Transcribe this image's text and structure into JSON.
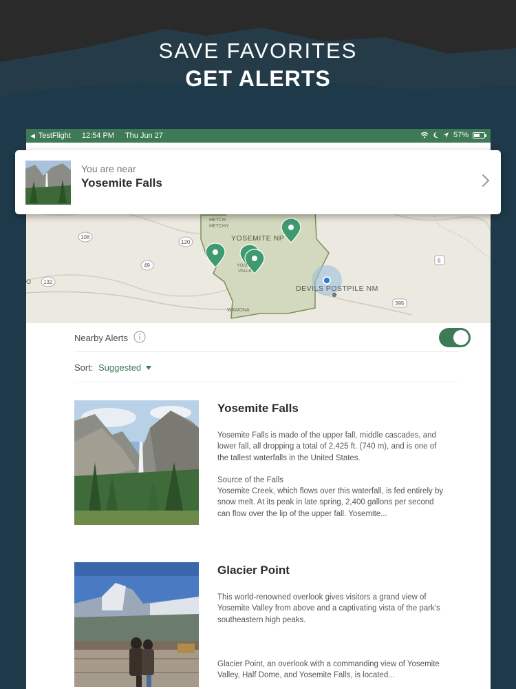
{
  "promo": {
    "line1": "SAVE FAVORITES",
    "line2": "GET ALERTS"
  },
  "statusbar": {
    "back_app": "TestFlight",
    "time": "12:54 PM",
    "date": "Thu Jun 27",
    "battery": "57%",
    "battery_level": 0.57
  },
  "near": {
    "subtitle": "You are near",
    "title": "Yosemite Falls"
  },
  "map": {
    "labels": {
      "hetch_1": "HETCH",
      "hetch_2": "HETCHY",
      "yosemite_np": "YOSEMITE NP",
      "yose_1": "YOSE",
      "yose_2": "VALLE",
      "devils_postpile": "DEVILS POSTPILE NM",
      "wawona": "WAWONA",
      "r108": "108",
      "r120": "120",
      "r49": "49",
      "r132": "132",
      "r6": "6",
      "r395": "395",
      "o_left": "O"
    }
  },
  "alerts": {
    "label": "Nearby Alerts",
    "enabled": true
  },
  "sort": {
    "label": "Sort:",
    "value": "Suggested"
  },
  "items": [
    {
      "title": "Yosemite Falls",
      "para1": "Yosemite Falls is made of the upper fall, middle cascades, and lower fall, all dropping a total of 2,425 ft. (740 m), and is one of the tallest waterfalls in the United States.",
      "para2_heading": "Source of the Falls",
      "para2": "Yosemite Creek, which flows over this waterfall, is fed entirely by snow melt. At its peak in late spring, 2,400 gallons per second can flow over the lip of the upper fall. Yosemite..."
    },
    {
      "title": "Glacier Point",
      "para1": "This world-renowned overlook gives visitors a grand view of Yosemite Valley from above and a captivating vista of the park's southeastern high peaks.",
      "para2": "Glacier Point, an overlook with a commanding view of Yosemite Valley, Half Dome, and Yosemite Falls, is located..."
    }
  ],
  "colors": {
    "brand_green": "#3d7a55",
    "promo_dark": "#2a2a2a",
    "promo_navy": "#1e3a4a"
  }
}
